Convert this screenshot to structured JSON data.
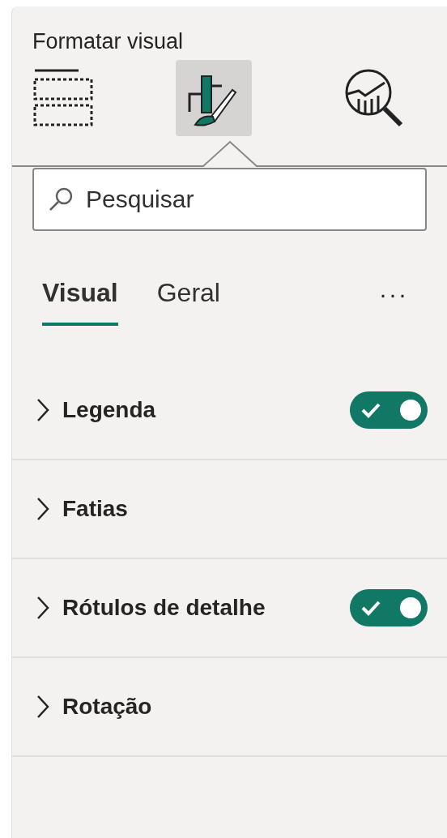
{
  "pane": {
    "title": "Formatar visual"
  },
  "view_buttons": [
    {
      "selected": false
    },
    {
      "selected": true
    },
    {
      "selected": false
    }
  ],
  "search": {
    "placeholder": "Pesquisar"
  },
  "tabs": [
    {
      "label": "Visual",
      "selected": true
    },
    {
      "label": "Geral",
      "selected": false
    }
  ],
  "more": "···",
  "sections": [
    {
      "label": "Legenda",
      "kind": "toggle",
      "on": true
    },
    {
      "label": "Fatias",
      "kind": "plain"
    },
    {
      "label": "Rótulos de detalhe",
      "kind": "toggle",
      "on": true
    },
    {
      "label": "Rotação",
      "kind": "plain"
    }
  ]
}
